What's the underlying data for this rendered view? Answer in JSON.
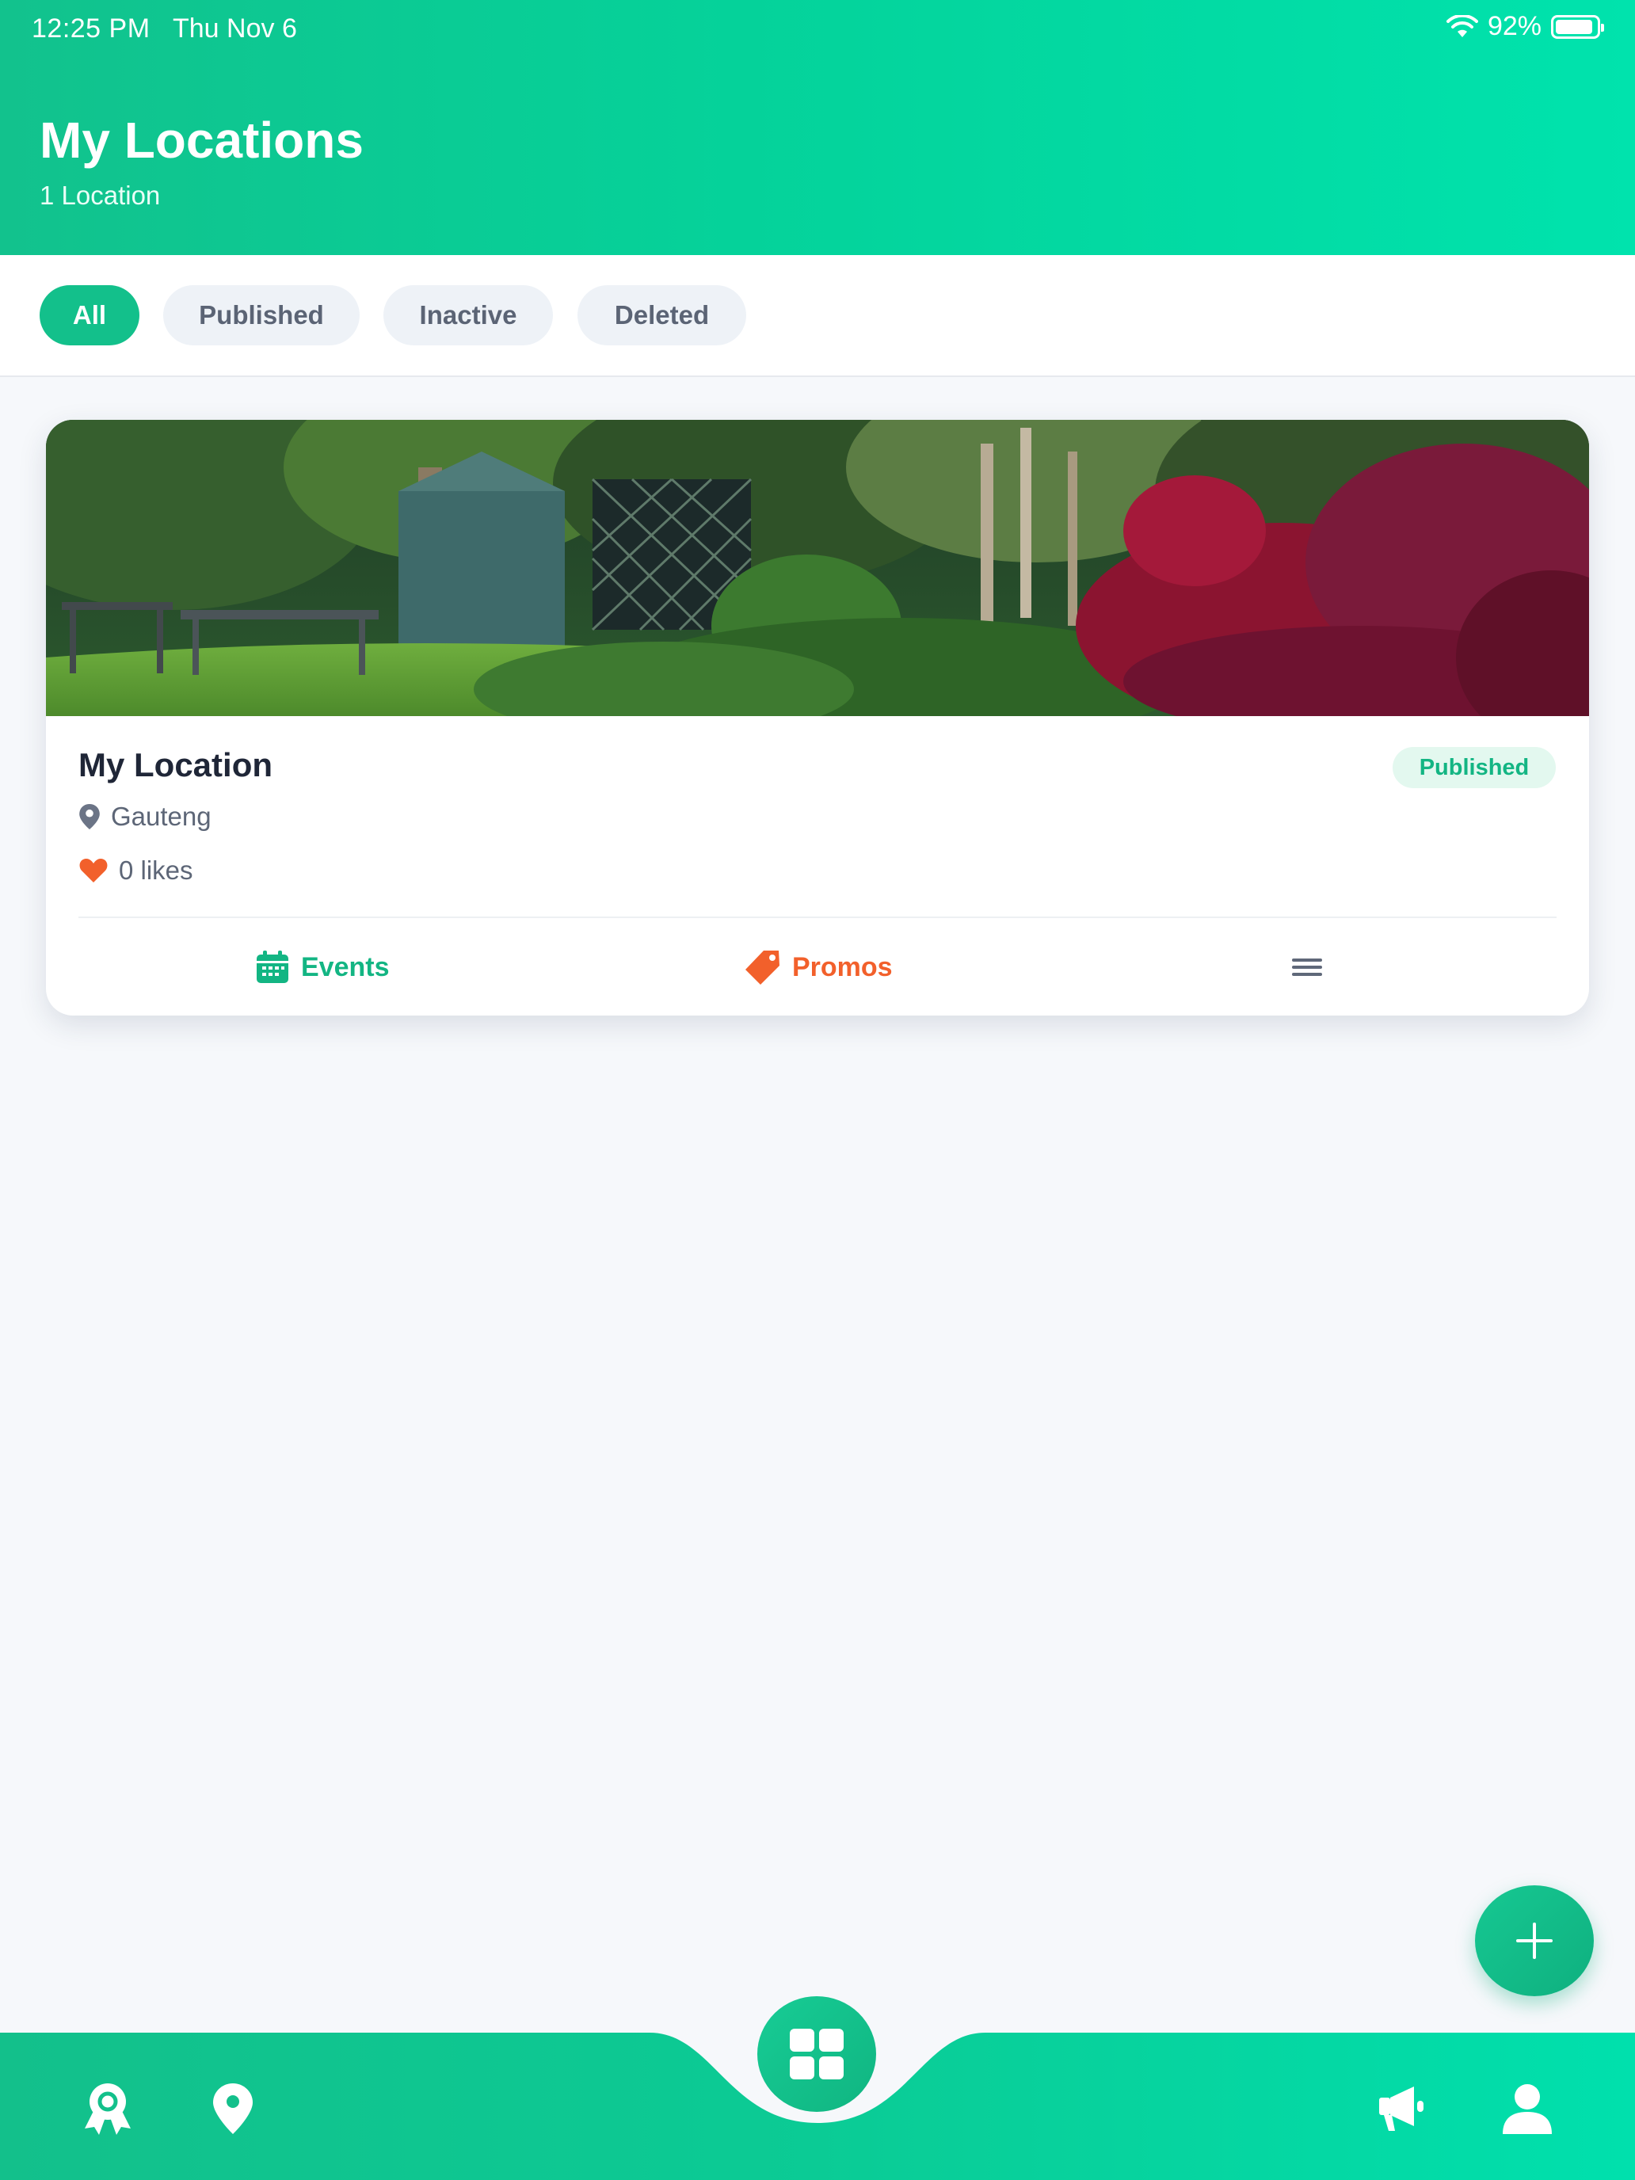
{
  "status_bar": {
    "time": "12:25 PM",
    "date": "Thu Nov 6",
    "battery_percent": "92%",
    "battery_level": 0.92,
    "wifi_icon": "wifi-icon"
  },
  "header": {
    "title": "My Locations",
    "subtitle": "1 Location"
  },
  "filters": {
    "tabs": [
      {
        "label": "All",
        "active": true
      },
      {
        "label": "Published",
        "active": false
      },
      {
        "label": "Inactive",
        "active": false
      },
      {
        "label": "Deleted",
        "active": false
      }
    ]
  },
  "locations": [
    {
      "name": "My Location",
      "status": "Published",
      "region": "Gauteng",
      "likes_text": "0 likes",
      "image": "garden-photo",
      "actions": {
        "events_label": "Events",
        "promos_label": "Promos",
        "more_icon": "menu-icon"
      }
    }
  ],
  "fab": {
    "icon": "plus-icon"
  },
  "bottom_nav": {
    "items": [
      {
        "icon": "award-icon"
      },
      {
        "icon": "map-pin-icon"
      },
      {
        "icon": "dashboard-grid-icon",
        "center": true
      },
      {
        "icon": "megaphone-icon"
      },
      {
        "icon": "user-icon"
      }
    ]
  },
  "colors": {
    "brand_green": "#13c08b",
    "promo_orange": "#f2602b",
    "background": "#f6f8fb"
  }
}
